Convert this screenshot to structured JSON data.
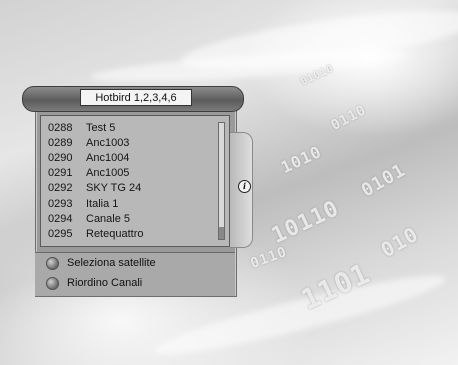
{
  "panel": {
    "title": "Hotbird 1,2,3,4,6"
  },
  "channels": [
    {
      "number": "0288",
      "name": "Test 5"
    },
    {
      "number": "0289",
      "name": "Anc1003"
    },
    {
      "number": "0290",
      "name": "Anc1004"
    },
    {
      "number": "0291",
      "name": "Anc1005"
    },
    {
      "number": "0292",
      "name": "SKY TG 24"
    },
    {
      "number": "0293",
      "name": "Italia 1"
    },
    {
      "number": "0294",
      "name": "Canale 5"
    },
    {
      "number": "0295",
      "name": "Retequattro"
    }
  ],
  "info_icon": {
    "glyph": "i",
    "icon": "info-icon"
  },
  "buttons": {
    "select_satellite": "Seleziona satellite",
    "reorder_channels": "Riordino Canali"
  },
  "background": {
    "binary_streams": [
      "01010",
      "0110",
      "1010",
      "0101",
      "10110",
      "010",
      "1101",
      "0110"
    ]
  }
}
